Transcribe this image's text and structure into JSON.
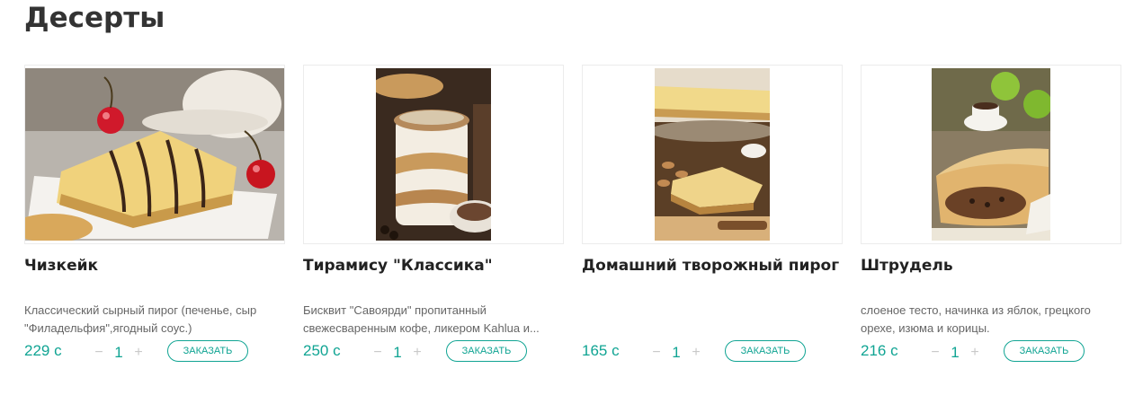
{
  "section": {
    "title": "Десерты"
  },
  "products": [
    {
      "name": "Чизкейк",
      "description": "Классический сырный пирог (печенье, сыр \"Филадельфия\",ягодный соус.)",
      "price": "229 с",
      "quantity": "1",
      "minus": "−",
      "plus": "+",
      "order_label": "ЗАКАЗАТЬ"
    },
    {
      "name": "Тирамису \"Классика\"",
      "description": "Бисквит \"Савоярди\" пропитанный свежесваренным кофе, ликером Kahlua и...",
      "price": "250 с",
      "quantity": "1",
      "minus": "−",
      "plus": "+",
      "order_label": "ЗАКАЗАТЬ"
    },
    {
      "name": "Домашний творожный пирог",
      "description": "",
      "price": "165 с",
      "quantity": "1",
      "minus": "−",
      "plus": "+",
      "order_label": "ЗАКАЗАТЬ"
    },
    {
      "name": "Штрудель",
      "description": "слоеное тесто, начинка из яблок, грецкого орехе, изюма и корицы.",
      "price": "216 с",
      "quantity": "1",
      "minus": "−",
      "plus": "+",
      "order_label": "ЗАКАЗАТЬ"
    }
  ],
  "colors": {
    "accent": "#10a493",
    "title": "#333333",
    "muted": "#666666"
  }
}
